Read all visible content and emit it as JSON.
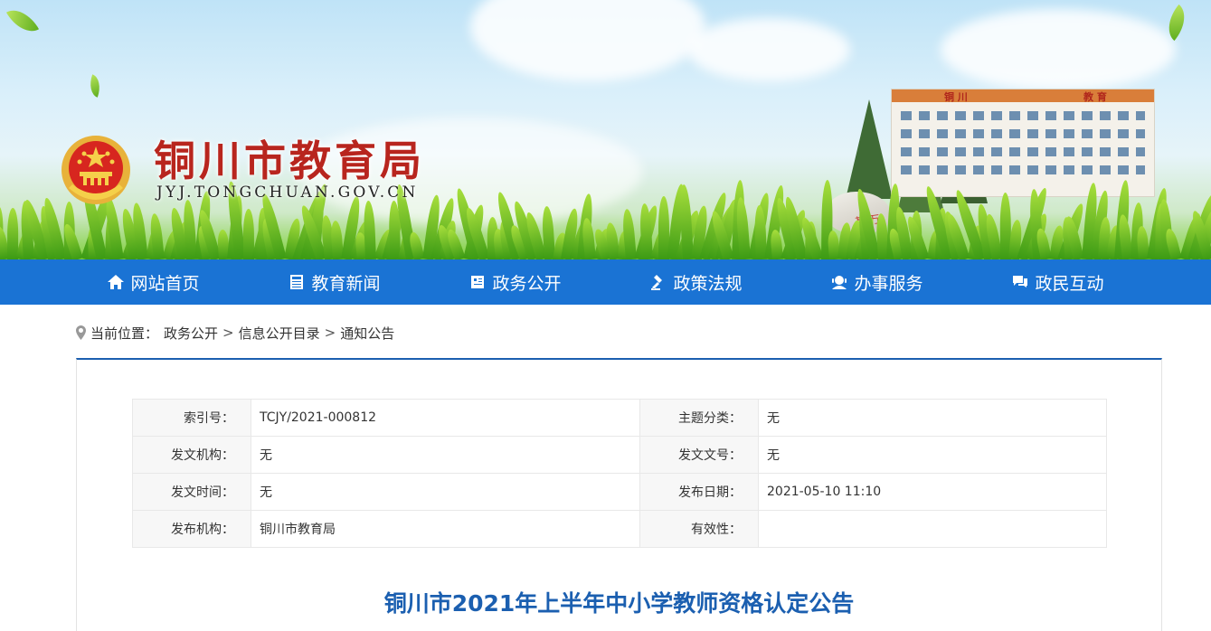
{
  "header": {
    "title": "铜川市教育局",
    "domain": "JYJ.TONGCHUAN.GOV.CN",
    "building_sign_left": "铜 川",
    "building_sign_right": "教 育",
    "rock_text": "基 万"
  },
  "nav": {
    "items": [
      {
        "label": "网站首页",
        "icon": "home-icon"
      },
      {
        "label": "教育新闻",
        "icon": "newspaper-icon"
      },
      {
        "label": "政务公开",
        "icon": "document-icon"
      },
      {
        "label": "政策法规",
        "icon": "gavel-icon"
      },
      {
        "label": "办事服务",
        "icon": "user-service-icon"
      },
      {
        "label": "政民互动",
        "icon": "chat-icon"
      }
    ]
  },
  "breadcrumb": {
    "prefix": "当前位置：",
    "items": [
      "政务公开",
      "信息公开目录",
      "通知公告"
    ],
    "separator": ">"
  },
  "meta": {
    "rows": [
      {
        "l1": "索引号：",
        "v1": "TCJY/2021-000812",
        "l2": "主题分类：",
        "v2": "无"
      },
      {
        "l1": "发文机构：",
        "v1": "无",
        "l2": "发文文号：",
        "v2": "无"
      },
      {
        "l1": "发文时间：",
        "v1": "无",
        "l2": "发布日期：",
        "v2": "2021-05-10 11:10"
      },
      {
        "l1": "发布机构：",
        "v1": "铜川市教育局",
        "l2": "有效性：",
        "v2": ""
      }
    ]
  },
  "article": {
    "title": "铜川市2021年上半年中小学教师资格认定公告"
  },
  "colors": {
    "nav_bg": "#1a73d4",
    "title_red": "#b8251e",
    "article_blue": "#1b5fb0"
  }
}
